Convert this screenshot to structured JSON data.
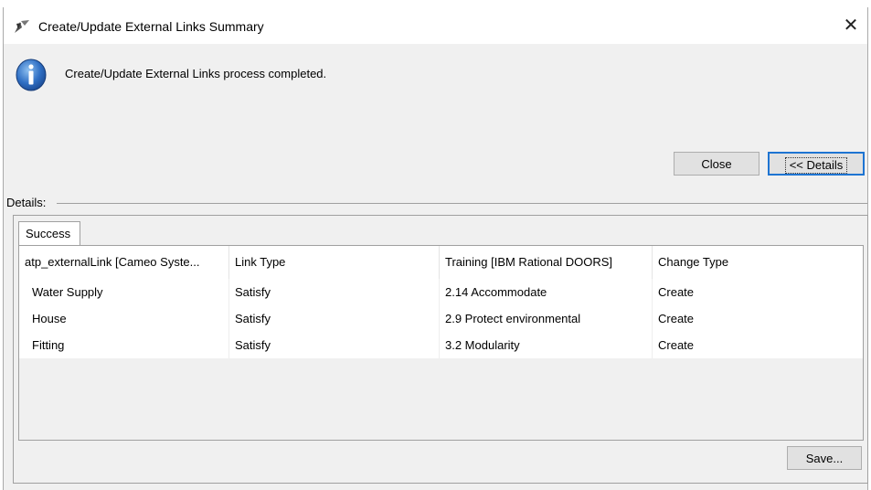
{
  "window": {
    "title": "Create/Update External Links Summary",
    "app_icon": "cameo-app-icon",
    "close_symbol": "✕"
  },
  "message": {
    "icon": "info-icon",
    "text": "Create/Update External Links process completed."
  },
  "buttons": {
    "close_label": "Close",
    "details_label": "<< Details",
    "save_label": "Save..."
  },
  "details": {
    "label": "Details:",
    "tabs": [
      {
        "label": "Success"
      }
    ],
    "columns": [
      "atp_externalLink [Cameo Syste...",
      "Link Type",
      "Training [IBM Rational DOORS]",
      "Change Type"
    ],
    "rows": [
      [
        "Water Supply",
        "Satisfy",
        "2.14 Accommodate",
        "Create"
      ],
      [
        "House",
        "Satisfy",
        "2.9 Protect environmental",
        "Create"
      ],
      [
        "Fitting",
        "Satisfy",
        "3.2 Modularity",
        "Create"
      ]
    ]
  },
  "colors": {
    "window_bg": "#f0f0f0",
    "info_blue": "#1e5aa8",
    "focus_border": "#1e74d2"
  }
}
